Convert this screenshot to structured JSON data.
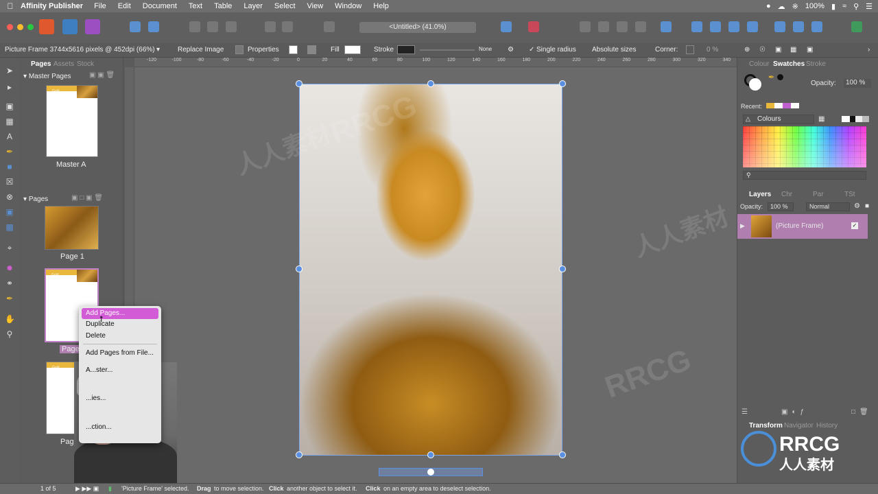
{
  "menubar": {
    "app_name": "Affinity Publisher",
    "items": [
      "File",
      "Edit",
      "Document",
      "Text",
      "Table",
      "Layer",
      "Select",
      "View",
      "Window",
      "Help"
    ],
    "battery": "100%",
    "clock": "",
    "apple_icon": "apple-icon"
  },
  "toolbar": {
    "document_title": "<Untitled> (41.0%)"
  },
  "context_bar": {
    "selection_info": "Picture Frame 3744x5616 pixels @ 452dpi (66%)",
    "replace_image": "Replace Image",
    "properties": "Properties",
    "fill_label": "Fill",
    "stroke_label": "Stroke",
    "stroke_value": "None",
    "single_radius": "Single radius",
    "absolute_sizes": "Absolute sizes",
    "corner_label": "Corner:",
    "corner_value": "0 %"
  },
  "ruler": {
    "ticks": [
      "-120",
      "-100",
      "-80",
      "-60",
      "-40",
      "-20",
      "0",
      "20",
      "40",
      "60",
      "80",
      "100",
      "120",
      "140",
      "160",
      "180",
      "200",
      "220",
      "240",
      "260",
      "280",
      "300",
      "320",
      "340"
    ]
  },
  "pages_panel": {
    "tabs": [
      "Pages",
      "Assets",
      "Stock"
    ],
    "master_header": "Master Pages",
    "master_label": "Master A",
    "pages_header": "Pages",
    "page1_label": "Page 1",
    "page2_label": "Page",
    "page3_label": "Page",
    "thumb_band_text": "Gold"
  },
  "context_menu": {
    "items": [
      "Add Pages...",
      "Duplicate",
      "Delete",
      "Add Pages from File...",
      "A...ster...",
      "...ies...",
      "...ction..."
    ]
  },
  "right_panel": {
    "top_tabs": [
      "Colour",
      "Swatches",
      "Stroke"
    ],
    "opacity_label": "Opacity:",
    "opacity_value": "100 %",
    "recent_label": "Recent:",
    "palette_name": "Colours",
    "layer_tabs": [
      "Layers",
      "Chr",
      "Par",
      "TSt"
    ],
    "layer_opacity_label": "Opacity:",
    "layer_opacity_value": "100 %",
    "blend_mode": "Normal",
    "layer_name": "(Picture Frame)",
    "bottom_tabs": [
      "Transform",
      "Navigator",
      "History"
    ]
  },
  "status_bar": {
    "page_counter": "1 of 5",
    "message_a": "'Picture Frame' selected.",
    "drag": "Drag",
    "message_b": "to move selection.",
    "click": "Click",
    "message_c": "another object to select it.",
    "click2": "Click",
    "message_d": "on an empty area to deselect selection."
  },
  "watermarks": [
    "RRCG",
    "人人素材"
  ]
}
